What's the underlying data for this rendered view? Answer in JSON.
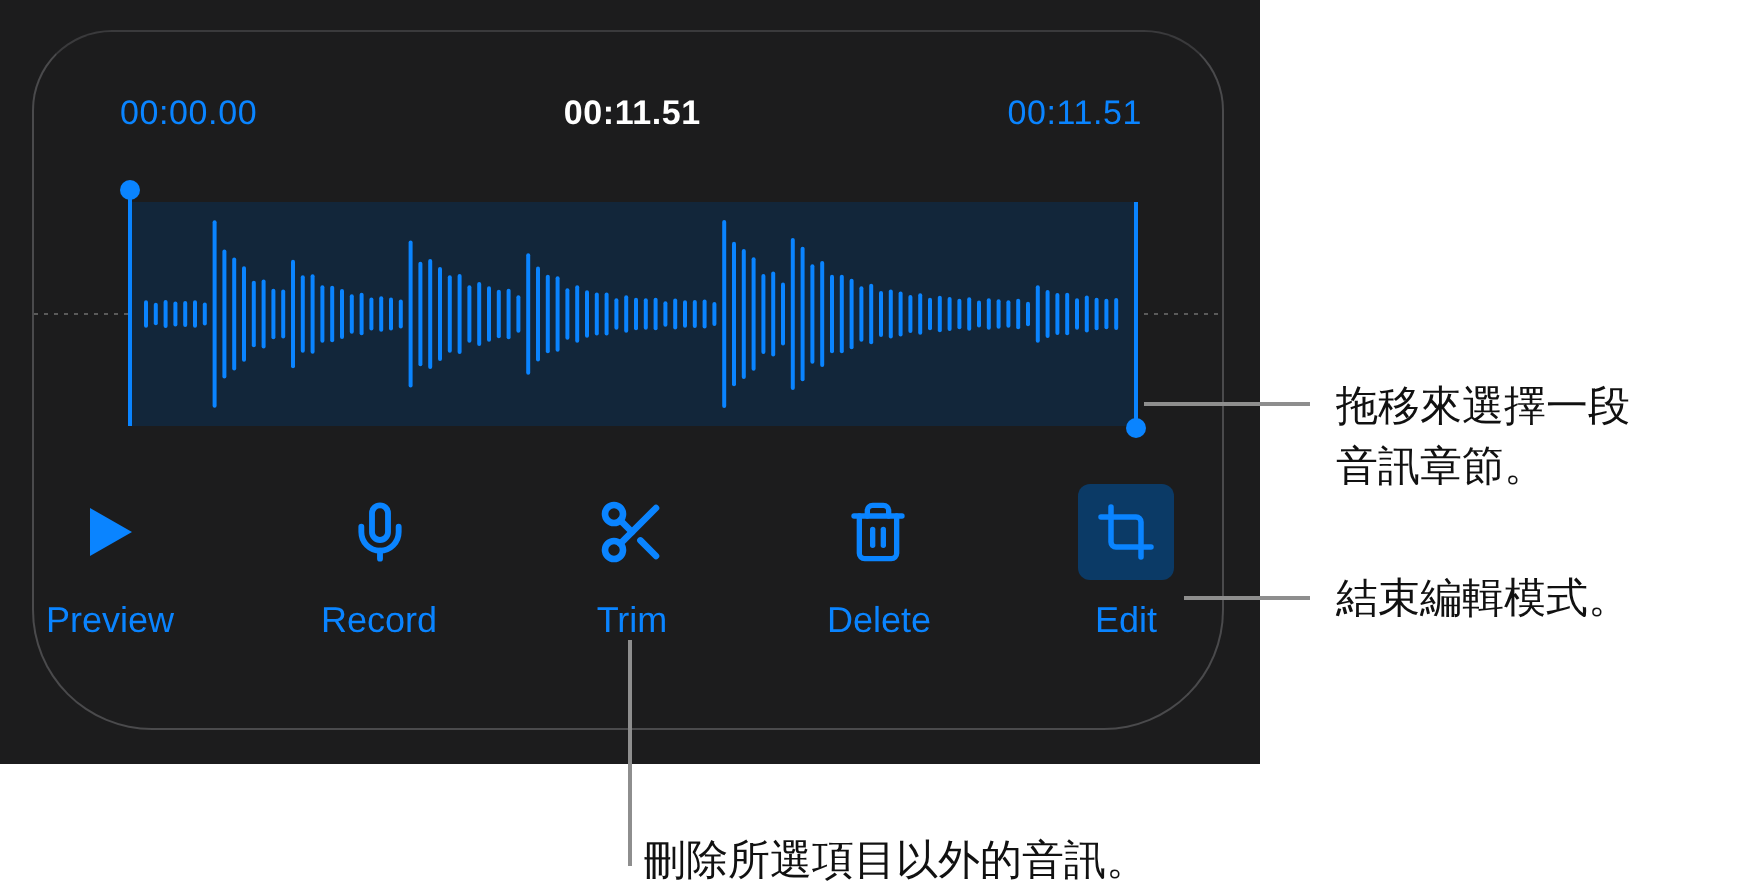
{
  "times": [
    {
      "text": "00:00.00",
      "kind": "start"
    },
    {
      "text": "00:11.51",
      "kind": "current"
    },
    {
      "text": "00:11.51",
      "kind": "end"
    }
  ],
  "tools": [
    {
      "label": "Preview",
      "kind": "play",
      "selected": false
    },
    {
      "label": "Record",
      "kind": "mic",
      "selected": false
    },
    {
      "label": "Trim",
      "kind": "scissors",
      "selected": false
    },
    {
      "label": "Delete",
      "kind": "trash",
      "selected": false
    },
    {
      "label": "Edit",
      "kind": "crop",
      "selected": true
    }
  ],
  "callouts": [
    {
      "text": "拖移來選擇一段音訊章節。"
    },
    {
      "text": "結束編輯模式。"
    },
    {
      "text": "刪除所選項目以外的音訊。"
    }
  ]
}
